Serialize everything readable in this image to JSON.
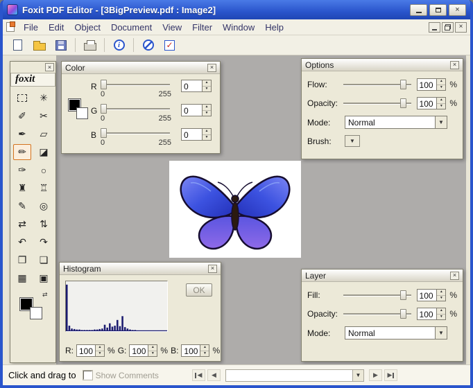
{
  "titlebar": {
    "title": "Foxit PDF Editor - [3BigPreview.pdf : Image2]"
  },
  "menubar": {
    "items": [
      {
        "label": "File"
      },
      {
        "label": "Edit"
      },
      {
        "label": "Object"
      },
      {
        "label": "Document"
      },
      {
        "label": "View"
      },
      {
        "label": "Filter"
      },
      {
        "label": "Window"
      },
      {
        "label": "Help"
      }
    ]
  },
  "toolbar": {
    "buttons": [
      "new",
      "open",
      "save",
      "print",
      "info",
      "prohibit",
      "check"
    ]
  },
  "toolbox": {
    "logo": "foxit",
    "tools": [
      {
        "name": "marquee-select-tool",
        "glyph": ""
      },
      {
        "name": "magic-wand-tool",
        "glyph": "✳"
      },
      {
        "name": "lasso-tool",
        "glyph": "✐"
      },
      {
        "name": "polygon-lasso-tool",
        "glyph": "✂"
      },
      {
        "name": "pen-tool",
        "glyph": "✒"
      },
      {
        "name": "eraser-tool",
        "glyph": "▱"
      },
      {
        "name": "brush-tool",
        "glyph": "✏",
        "selected": true
      },
      {
        "name": "paint-bucket-tool",
        "glyph": "◪"
      },
      {
        "name": "eyedropper-tool",
        "glyph": "✑"
      },
      {
        "name": "ellipse-tool",
        "glyph": "○"
      },
      {
        "name": "stamp-tool",
        "glyph": "♜"
      },
      {
        "name": "clone-stamp-tool",
        "glyph": "♖"
      },
      {
        "name": "pencil-tool",
        "glyph": "✎"
      },
      {
        "name": "zoom-tool",
        "glyph": "◎"
      },
      {
        "name": "flip-horizontal-tool",
        "glyph": "⇄"
      },
      {
        "name": "flip-vertical-tool",
        "glyph": "⇅"
      },
      {
        "name": "undo-tool",
        "glyph": "↶"
      },
      {
        "name": "redo-tool",
        "glyph": "↷"
      },
      {
        "name": "copy-tool",
        "glyph": "❐"
      },
      {
        "name": "paste-tool",
        "glyph": "❏"
      },
      {
        "name": "crop-tool",
        "glyph": "▦"
      },
      {
        "name": "save-tool",
        "glyph": "▣"
      }
    ]
  },
  "color_palette": {
    "title": "Color",
    "channels": [
      {
        "label": "R",
        "min": "0",
        "max": "255",
        "value": "0"
      },
      {
        "label": "G",
        "min": "0",
        "max": "255",
        "value": "0"
      },
      {
        "label": "B",
        "min": "0",
        "max": "255",
        "value": "0"
      }
    ]
  },
  "options_palette": {
    "title": "Options",
    "rows": {
      "flow": {
        "label": "Flow:",
        "value": "100",
        "unit": "%"
      },
      "opacity": {
        "label": "Opacity:",
        "value": "100",
        "unit": "%"
      },
      "mode": {
        "label": "Mode:",
        "value": "Normal"
      },
      "brush": {
        "label": "Brush:"
      }
    }
  },
  "histogram_palette": {
    "title": "Histogram",
    "ok_label": "OK",
    "channels": [
      {
        "label": "R:",
        "value": "100",
        "unit": "%"
      },
      {
        "label": "G:",
        "value": "100",
        "unit": "%"
      },
      {
        "label": "B:",
        "value": "100",
        "unit": "%"
      }
    ],
    "chart": {
      "type": "bar",
      "color": "#1b1b6f",
      "values": [
        96,
        10,
        4,
        3,
        2,
        2,
        1,
        1,
        1,
        1,
        1,
        2,
        2,
        3,
        4,
        12,
        6,
        15,
        8,
        10,
        22,
        9,
        30,
        7,
        4,
        2,
        1,
        1,
        0,
        0,
        0,
        0,
        0,
        0,
        0,
        0,
        0,
        0,
        0,
        0
      ]
    }
  },
  "layer_palette": {
    "title": "Layer",
    "rows": {
      "fill": {
        "label": "Fill:",
        "value": "100",
        "unit": "%"
      },
      "opacity": {
        "label": "Opacity:",
        "value": "100",
        "unit": "%"
      },
      "mode": {
        "label": "Mode:",
        "value": "Normal"
      }
    }
  },
  "statusbar": {
    "hint": "Click and drag to",
    "show_comments_label": "Show Comments"
  },
  "icons": {
    "close": "×",
    "palette_close": "×",
    "arrow_down": "▼",
    "spin_up": "▲",
    "spin_down": "▼",
    "prev": "◀",
    "next": "▶",
    "check": "✓",
    "info": "i",
    "swap": "⇄"
  },
  "colors": {
    "titlebar_blue": "#2a55cc",
    "canvas_gray": "#aeacaa",
    "histogram_bar": "#1b1b6f",
    "selected_tool_highlight": "#d4731f"
  }
}
